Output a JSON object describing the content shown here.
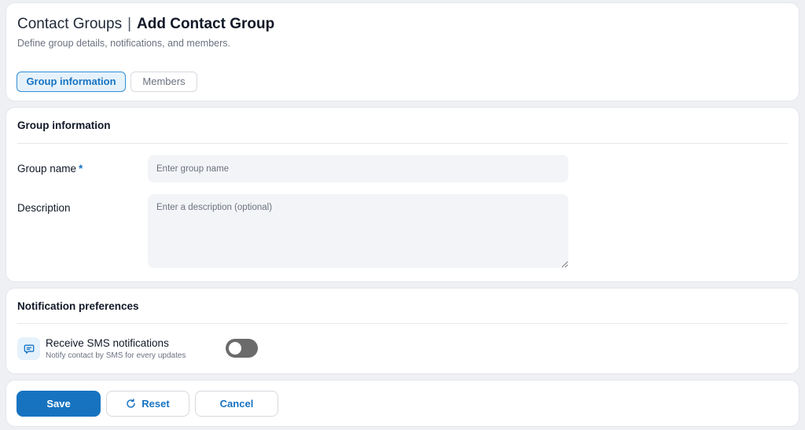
{
  "header": {
    "crumb": "Contact Groups",
    "separator": "|",
    "current": "Add Contact Group",
    "subtitle": "Define group details, notifications, and members."
  },
  "tabs": [
    {
      "label": "Group information",
      "active": true
    },
    {
      "label": "Members",
      "active": false
    }
  ],
  "group_info": {
    "title": "Group information",
    "name_label": "Group name",
    "required_mark": "*",
    "name_value": "",
    "name_placeholder": "Enter group name",
    "description_label": "Description",
    "description_value": "",
    "description_placeholder": "Enter a description (optional)"
  },
  "notifications": {
    "title": "Notification preferences",
    "icon": "message-icon",
    "sms_title": "Receive SMS notifications",
    "sms_subtitle": "Notify contact by SMS for every updates",
    "sms_enabled": false
  },
  "actions": {
    "save_label": "Save",
    "reset_label": "Reset",
    "reset_icon": "refresh-icon",
    "cancel_label": "Cancel"
  },
  "colors": {
    "accent": "#1773c0",
    "accent_light": "#e6f2fb",
    "toggle_off": "#6b6b6b"
  }
}
